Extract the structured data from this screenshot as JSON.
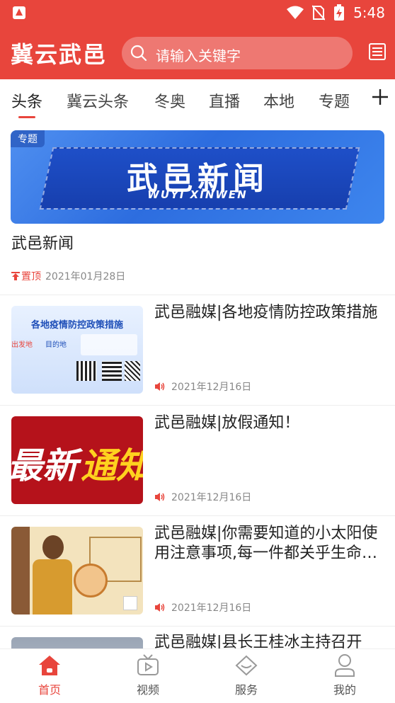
{
  "status_bar": {
    "time": "5:48"
  },
  "header": {
    "app_title": "冀云武邑",
    "search_placeholder": "请输入关键字"
  },
  "tabs": [
    "头条",
    "冀云头条",
    "冬奥",
    "直播",
    "本地",
    "专题"
  ],
  "banner": {
    "tag": "专题",
    "title": "武邑新闻",
    "subtitle": "WUYI XINWEN"
  },
  "featured": {
    "title": "武邑新闻",
    "pin_label": "置顶",
    "date": "2021年01月28日"
  },
  "articles": [
    {
      "title": "武邑融媒|各地疫情防控政策措施",
      "date": "2021年12月16日",
      "thumb_text": {
        "headline": "各地疫情防控政策措施",
        "from": "出发地",
        "to": "目的地"
      }
    },
    {
      "title": "武邑融媒|放假通知！",
      "date": "2021年12月16日",
      "thumb_text": {
        "a": "最新",
        "b": "通知"
      }
    },
    {
      "title": "武邑融媒|你需要知道的小太阳使用注意事项,每一件都关乎生命安全",
      "date": "2021年12月16日"
    },
    {
      "title": "武邑融媒|县长王桂冰主持召开",
      "date": ""
    }
  ],
  "bottom_nav": [
    "首页",
    "视频",
    "服务",
    "我的"
  ],
  "colors": {
    "brand_red": "#e8453c",
    "text_dark": "#222222",
    "text_muted": "#888888"
  }
}
